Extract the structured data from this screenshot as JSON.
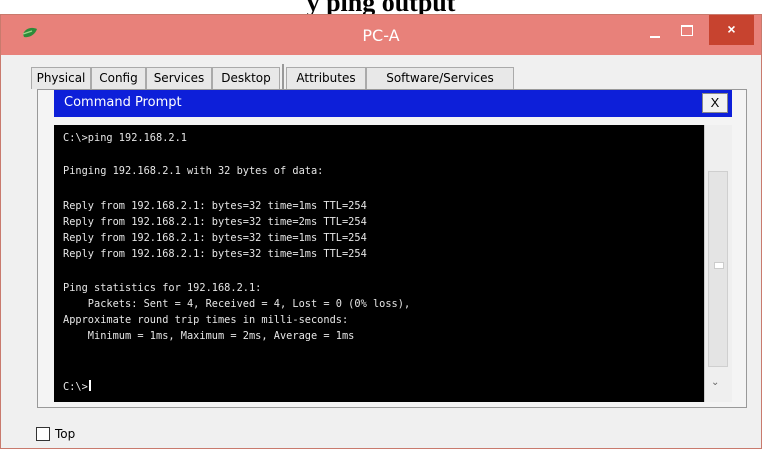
{
  "document": {
    "heading": "y ping output"
  },
  "window": {
    "title": "PC-A",
    "controls": {
      "minimize_icon": "minimize-icon",
      "maximize_icon": "maximize-icon",
      "close_symbol": "×"
    },
    "app_icon": "leaf-icon"
  },
  "tabs": [
    {
      "label": "Physical",
      "active": false
    },
    {
      "label": "Config",
      "active": false
    },
    {
      "label": "Services",
      "active": false
    },
    {
      "label": "Desktop",
      "active": true
    },
    {
      "label": "Attributes",
      "active": false
    },
    {
      "label": "Software/Services",
      "active": false
    }
  ],
  "command_prompt": {
    "title": "Command Prompt",
    "close_symbol": "X",
    "lines": [
      "C:\\>ping 192.168.2.1",
      "Pinging 192.168.2.1 with 32 bytes of data:",
      "Reply from 192.168.2.1: bytes=32 time=1ms TTL=254",
      "Reply from 192.168.2.1: bytes=32 time=2ms TTL=254",
      "Reply from 192.168.2.1: bytes=32 time=1ms TTL=254",
      "Reply from 192.168.2.1: bytes=32 time=1ms TTL=254",
      "Ping statistics for 192.168.2.1:",
      "    Packets: Sent = 4, Received = 4, Lost = 0 (0% loss),",
      "Approximate round trip times in milli-seconds:",
      "    Minimum = 1ms, Maximum = 2ms, Average = 1ms"
    ],
    "prompt": "C:\\>"
  },
  "footer": {
    "top_checkbox_label": "Top",
    "top_checked": false
  },
  "colors": {
    "titlebar": "#e8817a",
    "close_button": "#c7432f",
    "cmd_titlebar": "#0d1fd9",
    "terminal_bg": "#000000"
  }
}
